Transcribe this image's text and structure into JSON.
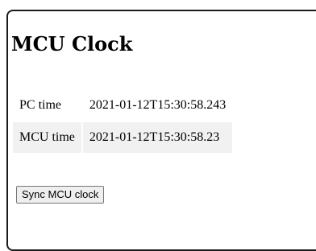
{
  "page": {
    "title": "MCU Clock"
  },
  "clock_table": {
    "rows": [
      {
        "label": "PC time",
        "value": "2021-01-12T15:30:58.243"
      },
      {
        "label": "MCU time",
        "value": "2021-01-12T15:30:58.23"
      }
    ]
  },
  "actions": {
    "sync_label": "Sync MCU clock"
  }
}
